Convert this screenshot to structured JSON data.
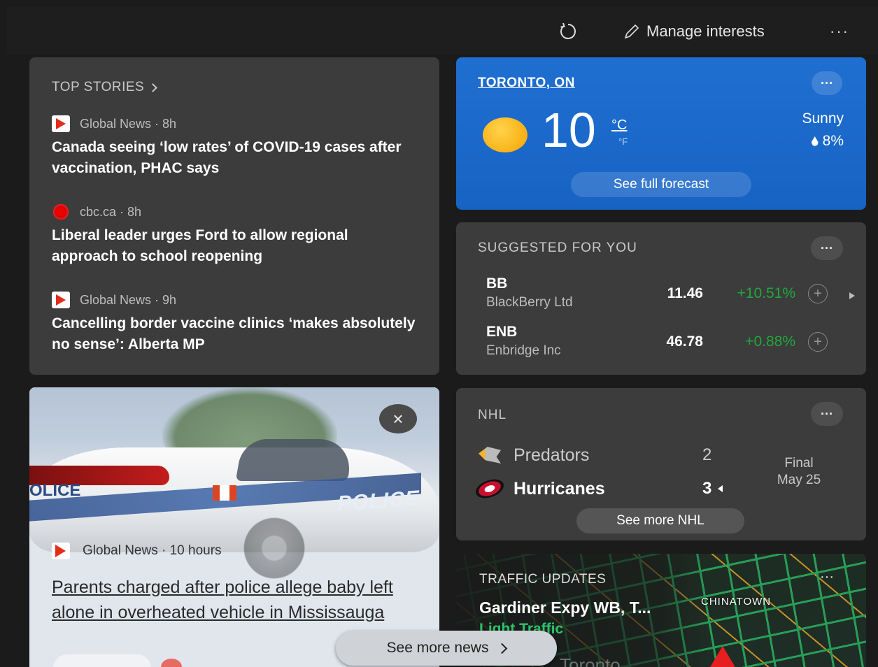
{
  "topbar": {
    "refresh_icon": "refresh-icon",
    "manage_label": "Manage interests",
    "more_label": "···"
  },
  "top_stories": {
    "heading": "TOP STORIES",
    "stories": [
      {
        "source": "Global News · 8h",
        "headline": "Canada seeing ‘low rates’ of COVID-19 cases after vaccination, PHAC says"
      },
      {
        "source": "cbc.ca · 8h",
        "headline": "Liberal leader urges Ford to allow regional approach to school reopening"
      },
      {
        "source": "Global News · 9h",
        "headline": "Cancelling border vaccine clinics ‘makes absolutely no sense’: Alberta MP"
      }
    ]
  },
  "weather": {
    "location": "TORONTO, ON",
    "temp": "10",
    "unit_c": "°C",
    "unit_f": "°F",
    "condition": "Sunny",
    "precip": "8%",
    "button": "See full forecast",
    "dots": "···"
  },
  "suggested": {
    "heading": "SUGGESTED FOR YOU",
    "dots": "···",
    "stocks": [
      {
        "symbol": "BB",
        "name": "BlackBerry Ltd",
        "price": "11.46",
        "change": "+10.51%"
      },
      {
        "symbol": "ENB",
        "name": "Enbridge Inc",
        "price": "46.78",
        "change": "+0.88%"
      }
    ]
  },
  "photo_news": {
    "car_text_left": "OLICE",
    "car_text_right": "POLICE",
    "source": "Global News · 10 hours",
    "headline": "Parents charged after police allege baby left alone in overheated vehicle in Mississauga",
    "close": "×"
  },
  "nhl": {
    "heading": "NHL",
    "dots": "···",
    "teams": [
      {
        "name": "Predators",
        "score": "2"
      },
      {
        "name": "Hurricanes",
        "score": "3"
      }
    ],
    "status": "Final",
    "date": "May 25",
    "button": "See more NHL"
  },
  "traffic": {
    "heading": "TRAFFIC UPDATES",
    "title": "Gardiner Expy WB, T...",
    "status": "Light Traffic",
    "map_label": "CHINATOWN",
    "city": "Toronto",
    "dots": "···"
  },
  "see_more": "See more news",
  "colors": {
    "accent": "#1f6fd1",
    "positive": "#1fa83a",
    "traffic": "#2cc46a"
  }
}
